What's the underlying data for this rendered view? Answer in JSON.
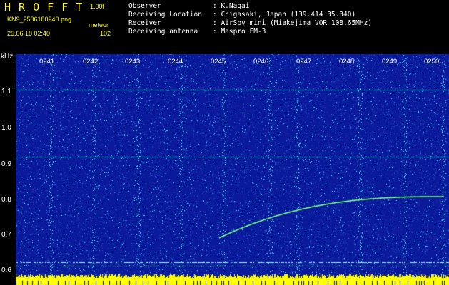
{
  "app": {
    "title": "H R O F F T",
    "version": "1.00f",
    "filename": "KN9_2506180240.png",
    "mode": "meteor",
    "datetime": "25.06.18 02:40",
    "count": "102"
  },
  "info": [
    {
      "label": "Observer",
      "value": ": K.Nagai"
    },
    {
      "label": "Receiving Location",
      "value": ": Chigasaki, Japan (139.414 35.340)"
    },
    {
      "label": "Receiver",
      "value": ": AirSpy mini (Miakejima VOR 108.65MHz)"
    },
    {
      "label": "Receiving antenna",
      "value": ": Maspro FM-3"
    }
  ],
  "axis": {
    "unit": "kHz",
    "y_ticks": [
      "1.1",
      "1.0",
      "0.9",
      "0.8",
      "0.7",
      "0.6"
    ],
    "x_ticks": [
      "0241",
      "0242",
      "0243",
      "0244",
      "0245",
      "0246",
      "0247",
      "0248",
      "0249",
      "0250"
    ]
  },
  "colors": {
    "background": "#0a1a9a",
    "noise": "#2ee0e8",
    "trace": "#7dff7a",
    "baseline": "#ffff00"
  }
}
